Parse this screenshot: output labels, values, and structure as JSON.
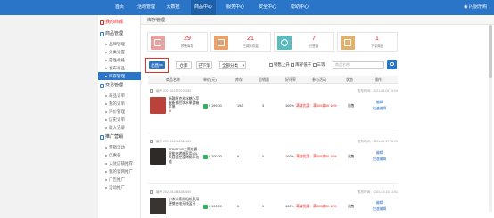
{
  "topnav": {
    "items": [
      "首页",
      "活动管理",
      "大数据",
      "商品中心",
      "服务中心",
      "安全中心",
      "帮助中心"
    ],
    "active_index": 3,
    "user": "闪厨乐购"
  },
  "sidebar": {
    "groups": [
      {
        "label": "我的商城"
      },
      {
        "label": "商品管理",
        "items": [
          "品牌管理",
          "分类设置",
          "属性规格",
          "发布商品",
          "库存管理"
        ]
      },
      {
        "label": "交易管理",
        "items": [
          "商品订单",
          "我的订单",
          "评价管理",
          "历史订单",
          "收入记录"
        ]
      },
      {
        "label": "推广营销",
        "items": [
          "营销活动",
          "优惠券",
          "入驻店铺推荐",
          "我的官网推广",
          "广告推广",
          "活动推广"
        ]
      }
    ],
    "active_item": "库存管理"
  },
  "tabbar": {
    "label": "库存管理"
  },
  "stats": [
    {
      "value": "29",
      "label": "预警库存",
      "color": "#e8a0a0"
    },
    {
      "value": "21",
      "label": "已减库存量",
      "color": "#e9a26e"
    },
    {
      "value": "7",
      "label": "已售罄",
      "color": "#5bbcbf"
    },
    {
      "value": "1",
      "label": "下架商品",
      "color": "#e0b070"
    }
  ],
  "filters": {
    "buttons": [
      "出售中",
      "仓库",
      "已下架"
    ],
    "category": "全部分类",
    "checks": [
      "销售上升",
      "库存低于",
      "三等"
    ],
    "search_placeholder": "商品名称"
  },
  "table": {
    "headers": [
      "商品名称",
      "单价(元)",
      "库存",
      "总销量",
      "好评率",
      "参与活动",
      "状态",
      "操作"
    ]
  },
  "orders": [
    {
      "no": "编号 2021012372078280",
      "time": "发布时间：2021-09-05 15:04",
      "name": "新疆阿克苏冰糖心苹果新鲜应季水果整箱苹果",
      "name_tail": "df",
      "price": "¥ 199.00",
      "stock": "192",
      "sales": "3",
      "rating": "100%",
      "activity": "满减优惠：满300减50 10%",
      "status": "出售",
      "ops": [
        "编辑",
        "快速编辑"
      ],
      "thumb_color": "#b9423a"
    },
    {
      "no": "编号 2021012562060183",
      "time": "发布时间：2021-09-17 15:09",
      "name": "TRUFFLE三黑松露智能电烤箱家用40L大容量控温烤箱多功能",
      "name_tail": "",
      "price": "¥ 200.00",
      "stock": "8",
      "sales": "0",
      "rating": "100%",
      "activity": "满减优惠：满300减50 10%",
      "status": "出售",
      "ops": [
        "编辑",
        "快速编辑"
      ],
      "thumb_color": "#2e2a28"
    },
    {
      "no": "编号 2021012448288550",
      "time": "发布时间：2021-09-16 11:51",
      "name": "小米米家照相机家用便携充电无线蓝牙",
      "name_tail": "",
      "price": "¥ 199.00",
      "stock": "6",
      "sales": "0",
      "rating": "100%",
      "activity": "满减优惠：满300减50 10%",
      "status": "出售",
      "ops": [
        "编辑",
        "快速编辑"
      ],
      "thumb_color": "#3a3430"
    }
  ]
}
